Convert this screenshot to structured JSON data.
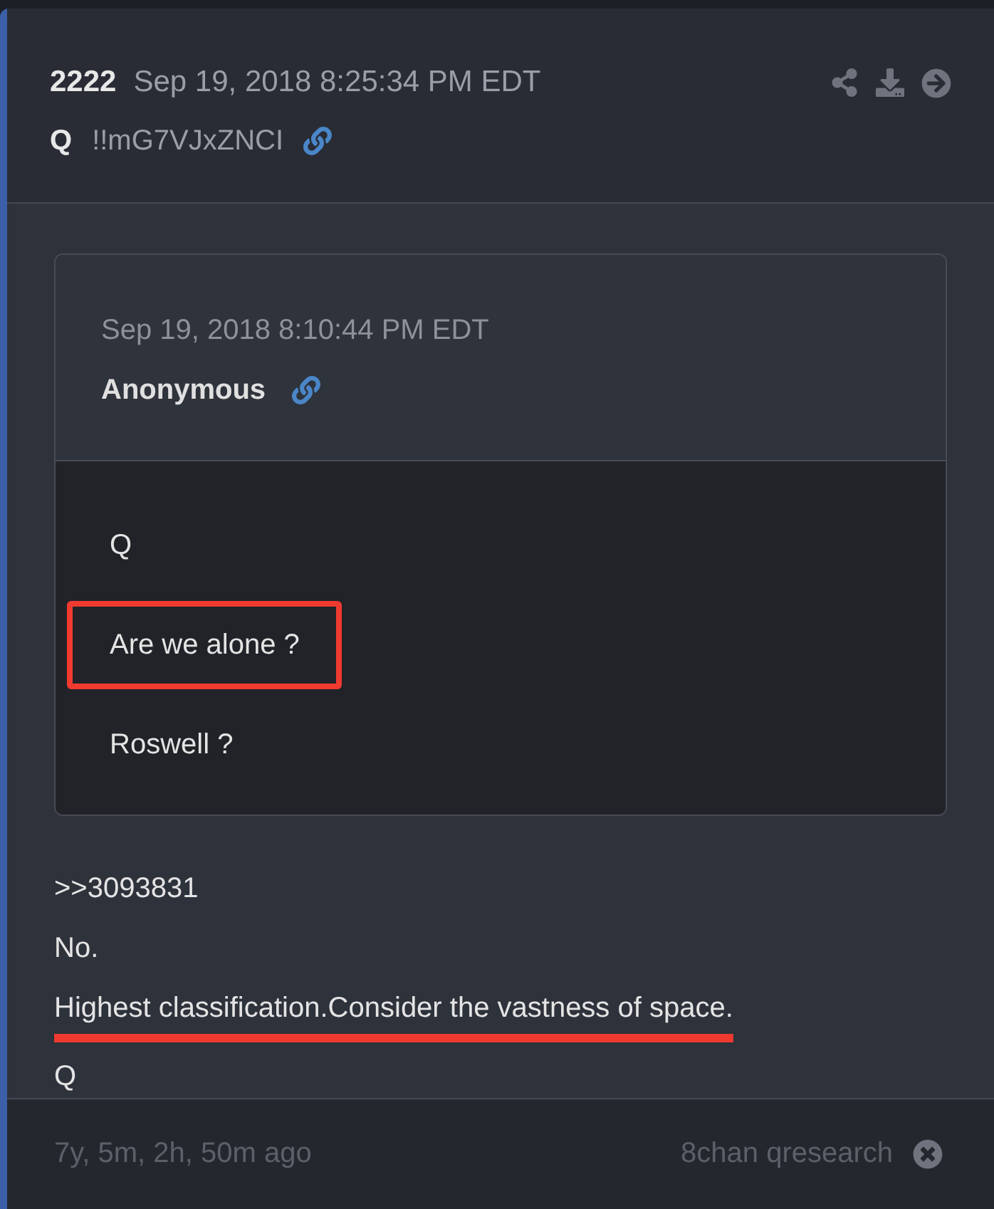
{
  "post": {
    "number": "2222",
    "timestamp": "Sep 19, 2018 8:25:34 PM EDT",
    "author": "Q",
    "tripcode": "!!mG7VJxZNCI"
  },
  "quote": {
    "timestamp": "Sep 19, 2018 8:10:44 PM EDT",
    "author": "Anonymous",
    "lines": [
      {
        "text": "Q",
        "highlighted": false
      },
      {
        "text": "Are we alone ?",
        "highlighted": true
      },
      {
        "text": "Roswell ?",
        "highlighted": false
      }
    ]
  },
  "reply": [
    {
      "text": ">>3093831",
      "underlined": false
    },
    {
      "text": "No.",
      "underlined": false
    },
    {
      "text": "Highest classification.Consider the vastness of space.",
      "underlined": true
    },
    {
      "text": "Q",
      "underlined": false
    }
  ],
  "footer": {
    "age": "7y, 5m, 2h, 50m ago",
    "source": "8chan qresearch"
  }
}
